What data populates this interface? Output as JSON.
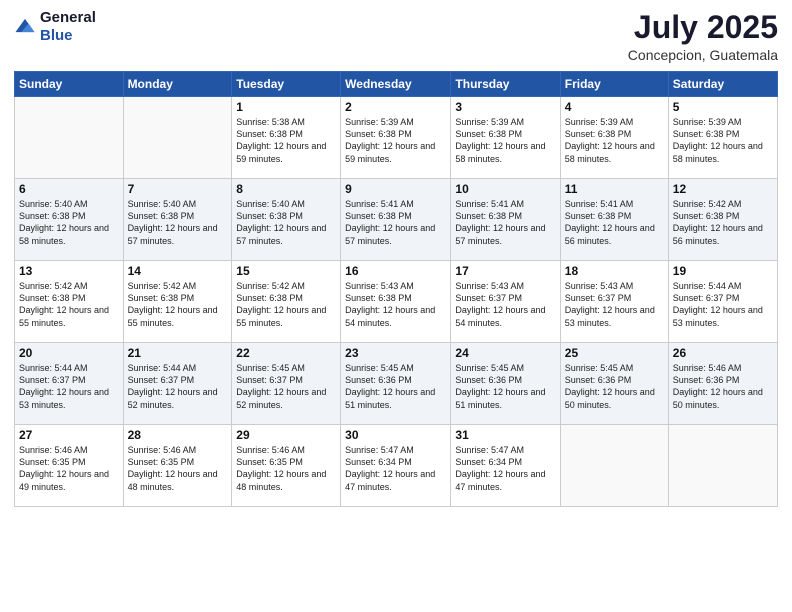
{
  "logo": {
    "text_general": "General",
    "text_blue": "Blue"
  },
  "title": "July 2025",
  "location": "Concepcion, Guatemala",
  "days_of_week": [
    "Sunday",
    "Monday",
    "Tuesday",
    "Wednesday",
    "Thursday",
    "Friday",
    "Saturday"
  ],
  "weeks": [
    [
      {
        "day": "",
        "sunrise": "",
        "sunset": "",
        "daylight": ""
      },
      {
        "day": "",
        "sunrise": "",
        "sunset": "",
        "daylight": ""
      },
      {
        "day": "1",
        "sunrise": "Sunrise: 5:38 AM",
        "sunset": "Sunset: 6:38 PM",
        "daylight": "Daylight: 12 hours and 59 minutes."
      },
      {
        "day": "2",
        "sunrise": "Sunrise: 5:39 AM",
        "sunset": "Sunset: 6:38 PM",
        "daylight": "Daylight: 12 hours and 59 minutes."
      },
      {
        "day": "3",
        "sunrise": "Sunrise: 5:39 AM",
        "sunset": "Sunset: 6:38 PM",
        "daylight": "Daylight: 12 hours and 58 minutes."
      },
      {
        "day": "4",
        "sunrise": "Sunrise: 5:39 AM",
        "sunset": "Sunset: 6:38 PM",
        "daylight": "Daylight: 12 hours and 58 minutes."
      },
      {
        "day": "5",
        "sunrise": "Sunrise: 5:39 AM",
        "sunset": "Sunset: 6:38 PM",
        "daylight": "Daylight: 12 hours and 58 minutes."
      }
    ],
    [
      {
        "day": "6",
        "sunrise": "Sunrise: 5:40 AM",
        "sunset": "Sunset: 6:38 PM",
        "daylight": "Daylight: 12 hours and 58 minutes."
      },
      {
        "day": "7",
        "sunrise": "Sunrise: 5:40 AM",
        "sunset": "Sunset: 6:38 PM",
        "daylight": "Daylight: 12 hours and 57 minutes."
      },
      {
        "day": "8",
        "sunrise": "Sunrise: 5:40 AM",
        "sunset": "Sunset: 6:38 PM",
        "daylight": "Daylight: 12 hours and 57 minutes."
      },
      {
        "day": "9",
        "sunrise": "Sunrise: 5:41 AM",
        "sunset": "Sunset: 6:38 PM",
        "daylight": "Daylight: 12 hours and 57 minutes."
      },
      {
        "day": "10",
        "sunrise": "Sunrise: 5:41 AM",
        "sunset": "Sunset: 6:38 PM",
        "daylight": "Daylight: 12 hours and 57 minutes."
      },
      {
        "day": "11",
        "sunrise": "Sunrise: 5:41 AM",
        "sunset": "Sunset: 6:38 PM",
        "daylight": "Daylight: 12 hours and 56 minutes."
      },
      {
        "day": "12",
        "sunrise": "Sunrise: 5:42 AM",
        "sunset": "Sunset: 6:38 PM",
        "daylight": "Daylight: 12 hours and 56 minutes."
      }
    ],
    [
      {
        "day": "13",
        "sunrise": "Sunrise: 5:42 AM",
        "sunset": "Sunset: 6:38 PM",
        "daylight": "Daylight: 12 hours and 55 minutes."
      },
      {
        "day": "14",
        "sunrise": "Sunrise: 5:42 AM",
        "sunset": "Sunset: 6:38 PM",
        "daylight": "Daylight: 12 hours and 55 minutes."
      },
      {
        "day": "15",
        "sunrise": "Sunrise: 5:42 AM",
        "sunset": "Sunset: 6:38 PM",
        "daylight": "Daylight: 12 hours and 55 minutes."
      },
      {
        "day": "16",
        "sunrise": "Sunrise: 5:43 AM",
        "sunset": "Sunset: 6:38 PM",
        "daylight": "Daylight: 12 hours and 54 minutes."
      },
      {
        "day": "17",
        "sunrise": "Sunrise: 5:43 AM",
        "sunset": "Sunset: 6:37 PM",
        "daylight": "Daylight: 12 hours and 54 minutes."
      },
      {
        "day": "18",
        "sunrise": "Sunrise: 5:43 AM",
        "sunset": "Sunset: 6:37 PM",
        "daylight": "Daylight: 12 hours and 53 minutes."
      },
      {
        "day": "19",
        "sunrise": "Sunrise: 5:44 AM",
        "sunset": "Sunset: 6:37 PM",
        "daylight": "Daylight: 12 hours and 53 minutes."
      }
    ],
    [
      {
        "day": "20",
        "sunrise": "Sunrise: 5:44 AM",
        "sunset": "Sunset: 6:37 PM",
        "daylight": "Daylight: 12 hours and 53 minutes."
      },
      {
        "day": "21",
        "sunrise": "Sunrise: 5:44 AM",
        "sunset": "Sunset: 6:37 PM",
        "daylight": "Daylight: 12 hours and 52 minutes."
      },
      {
        "day": "22",
        "sunrise": "Sunrise: 5:45 AM",
        "sunset": "Sunset: 6:37 PM",
        "daylight": "Daylight: 12 hours and 52 minutes."
      },
      {
        "day": "23",
        "sunrise": "Sunrise: 5:45 AM",
        "sunset": "Sunset: 6:36 PM",
        "daylight": "Daylight: 12 hours and 51 minutes."
      },
      {
        "day": "24",
        "sunrise": "Sunrise: 5:45 AM",
        "sunset": "Sunset: 6:36 PM",
        "daylight": "Daylight: 12 hours and 51 minutes."
      },
      {
        "day": "25",
        "sunrise": "Sunrise: 5:45 AM",
        "sunset": "Sunset: 6:36 PM",
        "daylight": "Daylight: 12 hours and 50 minutes."
      },
      {
        "day": "26",
        "sunrise": "Sunrise: 5:46 AM",
        "sunset": "Sunset: 6:36 PM",
        "daylight": "Daylight: 12 hours and 50 minutes."
      }
    ],
    [
      {
        "day": "27",
        "sunrise": "Sunrise: 5:46 AM",
        "sunset": "Sunset: 6:35 PM",
        "daylight": "Daylight: 12 hours and 49 minutes."
      },
      {
        "day": "28",
        "sunrise": "Sunrise: 5:46 AM",
        "sunset": "Sunset: 6:35 PM",
        "daylight": "Daylight: 12 hours and 48 minutes."
      },
      {
        "day": "29",
        "sunrise": "Sunrise: 5:46 AM",
        "sunset": "Sunset: 6:35 PM",
        "daylight": "Daylight: 12 hours and 48 minutes."
      },
      {
        "day": "30",
        "sunrise": "Sunrise: 5:47 AM",
        "sunset": "Sunset: 6:34 PM",
        "daylight": "Daylight: 12 hours and 47 minutes."
      },
      {
        "day": "31",
        "sunrise": "Sunrise: 5:47 AM",
        "sunset": "Sunset: 6:34 PM",
        "daylight": "Daylight: 12 hours and 47 minutes."
      },
      {
        "day": "",
        "sunrise": "",
        "sunset": "",
        "daylight": ""
      },
      {
        "day": "",
        "sunrise": "",
        "sunset": "",
        "daylight": ""
      }
    ]
  ]
}
